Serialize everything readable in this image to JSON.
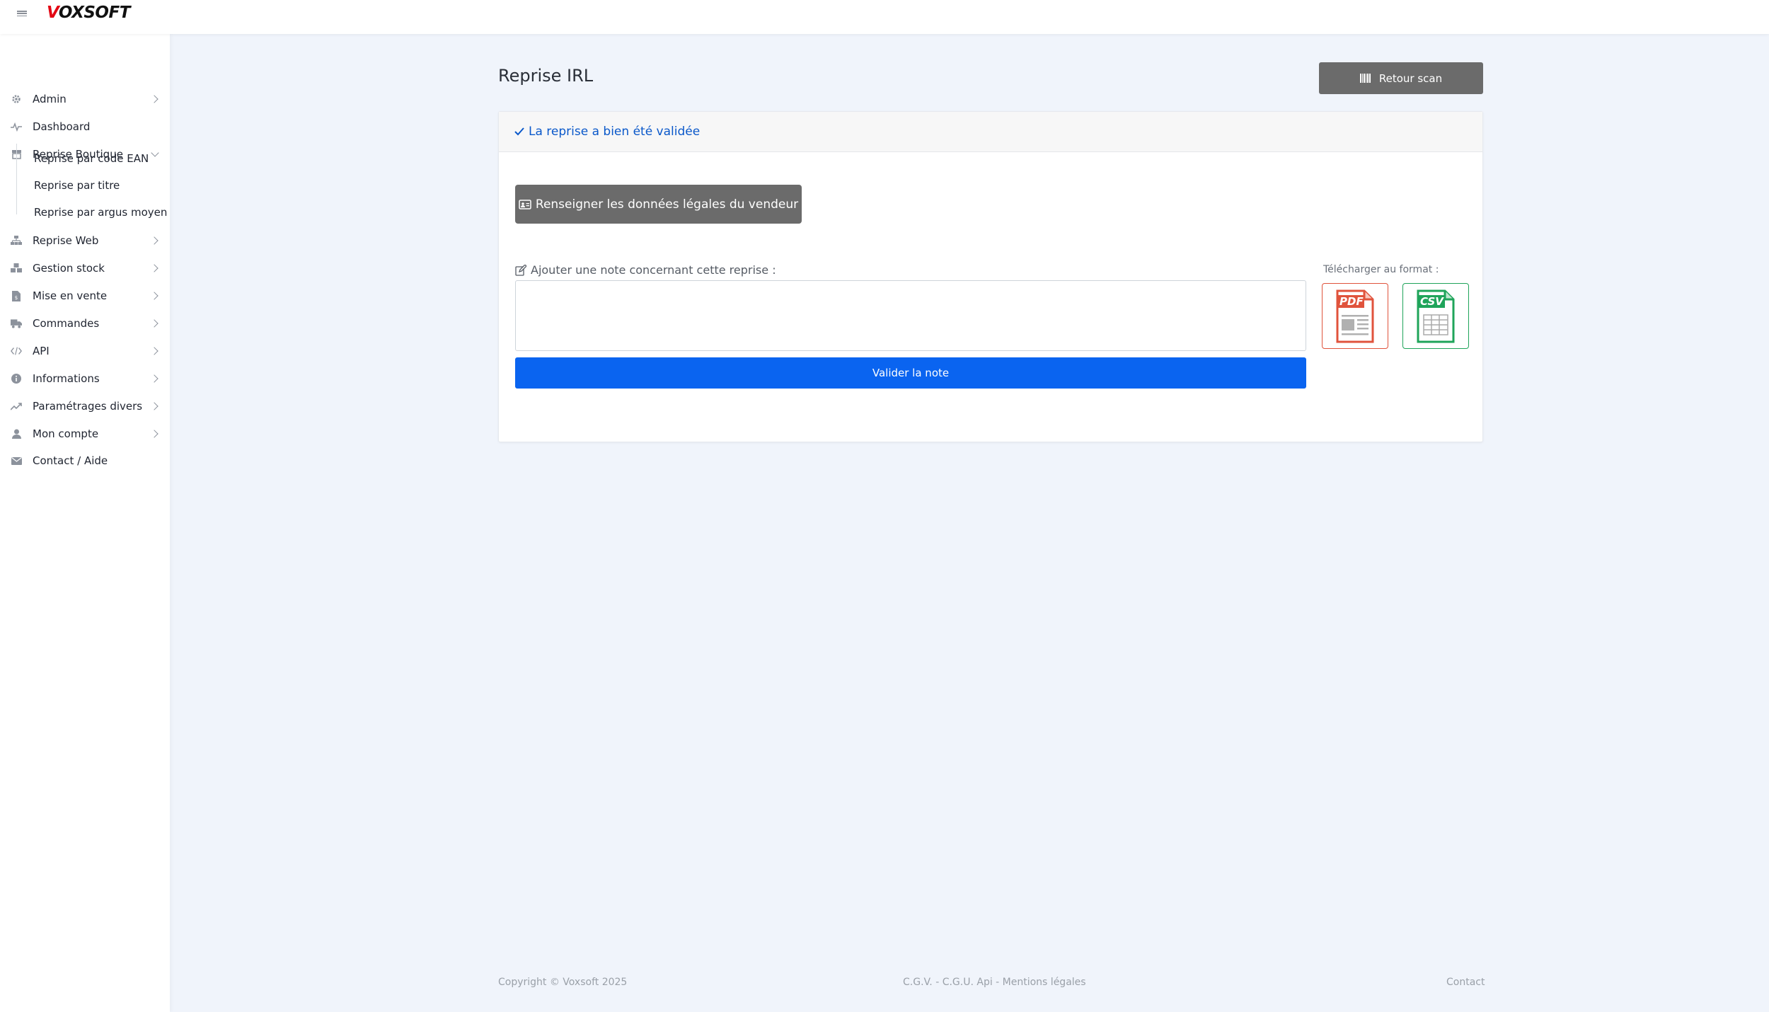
{
  "header": {
    "logo_v": "V",
    "logo_rest": "OXSOFT"
  },
  "sidebar": {
    "items": [
      {
        "label": "Admin"
      },
      {
        "label": "Dashboard"
      },
      {
        "label": "Reprise Boutique"
      },
      {
        "label": "Reprise Web"
      },
      {
        "label": "Gestion stock"
      },
      {
        "label": "Mise en vente"
      },
      {
        "label": "Commandes"
      },
      {
        "label": "API"
      },
      {
        "label": "Informations"
      },
      {
        "label": "Paramétrages divers"
      },
      {
        "label": "Mon compte"
      },
      {
        "label": "Contact / Aide"
      }
    ],
    "sub_items": [
      {
        "label": "Reprise par code EAN"
      },
      {
        "label": "Reprise par titre"
      },
      {
        "label": "Reprise par argus moyen"
      }
    ]
  },
  "main": {
    "title": "Reprise IRL",
    "retour_label": "Retour scan",
    "success_message": "La reprise a bien été validée",
    "legal_button_label": "Renseigner les données légales du vendeur",
    "note_label": "Ajouter une note concernant cette reprise :",
    "note_value": "",
    "validate_label": "Valider la note",
    "download_label": "Télécharger au format :",
    "pdf_text": "PDF",
    "csv_text": "CSV"
  },
  "footer": {
    "copyright": "Copyright © Voxsoft 2025",
    "links": "C.G.V. - C.G.U. Api - Mentions légales",
    "contact": "Contact"
  },
  "colors": {
    "accent_blue": "#0a64f0",
    "success_blue": "#0a58ca",
    "gray_button": "#6b6b6b",
    "pdf_red": "#e0533c",
    "csv_green": "#1fa45a",
    "brand_red": "#e30613"
  }
}
